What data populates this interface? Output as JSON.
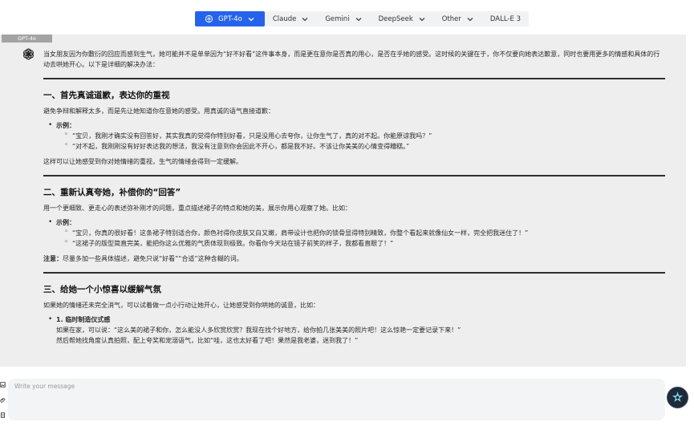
{
  "models": [
    {
      "label": "GPT-4o",
      "active": true
    },
    {
      "label": "Claude"
    },
    {
      "label": "Gemini"
    },
    {
      "label": "DeepSeek"
    },
    {
      "label": "Other"
    },
    {
      "label": "DALL-E 3"
    }
  ],
  "panel": {
    "model_label": "GPT-4o"
  },
  "message": {
    "intro": "当女朋友因为你敷衍的回应而感到生气，她可能并不是单单因为“好不好看”这件事本身，而是更在意你是否真的用心，是否在乎她的感受。这时候的关键在于，你不仅要向她表达歉意，同时也要用更多的情感和具体的行动去哄她开心。以下是详细的解决办法：",
    "sections": [
      {
        "title": "一、首先真诚道歉，表达你的重视",
        "desc": "避免争辩和解释太多，而是先让她知道你在意她的感受。用真诚的语气直接道歉：",
        "example_label": "示例：",
        "examples": [
          "“宝贝，我刚才确实没有回答好，其实我真的觉得你特别好看，只是没用心去夸你，让你生气了，真的对不起。你能原谅我吗？”",
          "“对不起，我刚刚没有好好表达我的想法，我没有注意到你会因此不开心，都是我不好。不该让你美美的心情变得糟糕。”"
        ],
        "after": "这样可以让她感受到你对她情绪的重视，生气的情绪会得到一定缓解。"
      },
      {
        "title": "二、重新认真夸她，补偿你的“回答”",
        "desc": "用一个更细致、更走心的表述弥补刚才的问题，重点描述裙子的特点和她的美，展示你用心观察了她。比如：",
        "example_label": "示例：",
        "examples": [
          "“宝贝，你真的很好看！这条裙子特别适合你，颜色衬得你皮肤又白又嫩，肩带设计也把你的锁骨显得特别精致，你整个看起来就像仙女一样，完全把我迷住了！”",
          "“这裙子的版型简直完美，能把你这么优雅的气质体现到极致。你看你今天站在镜子前笑的样子，我都看直眼了！”"
        ],
        "note_label": "注意：",
        "note": "尽量多加一些具体描述，避免只说“好看”“合适”这种含糊的词。"
      },
      {
        "title": "三、给她一个小惊喜以缓解气氛",
        "desc": "如果她的情绪还未完全消气，可以试着做一点小行动让她开心，让她感受到你哄她的诚意，比如：",
        "item_label": "1. 临时制造仪式感",
        "item_lines": [
          "如果在家，可以说：“这么美的裙子和你，怎么能没人多欣赏欣赏？我现在找个好地方，给你拍几张美美的照片吧！这么惊艳一定要记录下来！”",
          "然后帮她找角度认真拍照，配上夸奖和宠溺语气，比如“哇，这也太好看了吧！果然是我老婆，迷到我了！”"
        ]
      }
    ]
  },
  "input": {
    "placeholder": "Write your message"
  },
  "icons": {
    "assistant": "openai-logo-icon",
    "send": "star-logo-icon"
  }
}
